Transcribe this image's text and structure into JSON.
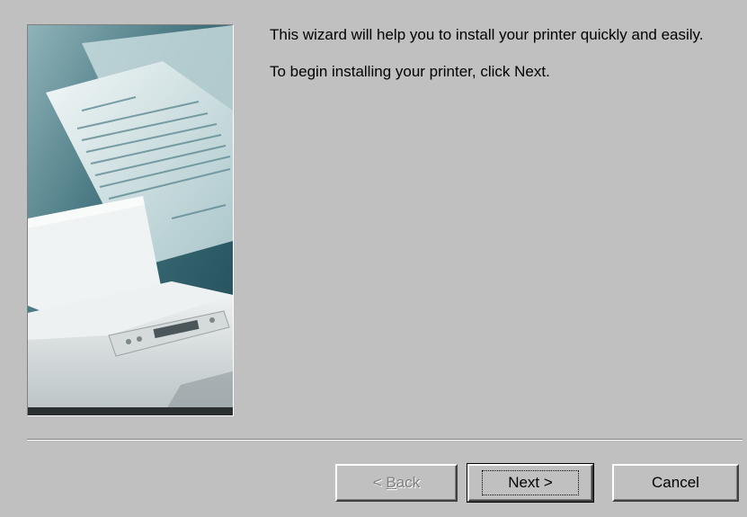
{
  "intro": {
    "line1": "This wizard will help you to install your printer quickly and easily.",
    "line2": "To begin installing your printer, click Next."
  },
  "buttons": {
    "back_prefix": "< ",
    "back_mnemonic": "B",
    "back_rest": "ack",
    "next_label": "Next >",
    "cancel_label": "Cancel"
  },
  "side_image": {
    "icon": "printer-with-paper-illustration",
    "colors": {
      "background": "#3e6f7a",
      "paper": "#dfe9ea",
      "printer": "#e6e9ea"
    }
  }
}
